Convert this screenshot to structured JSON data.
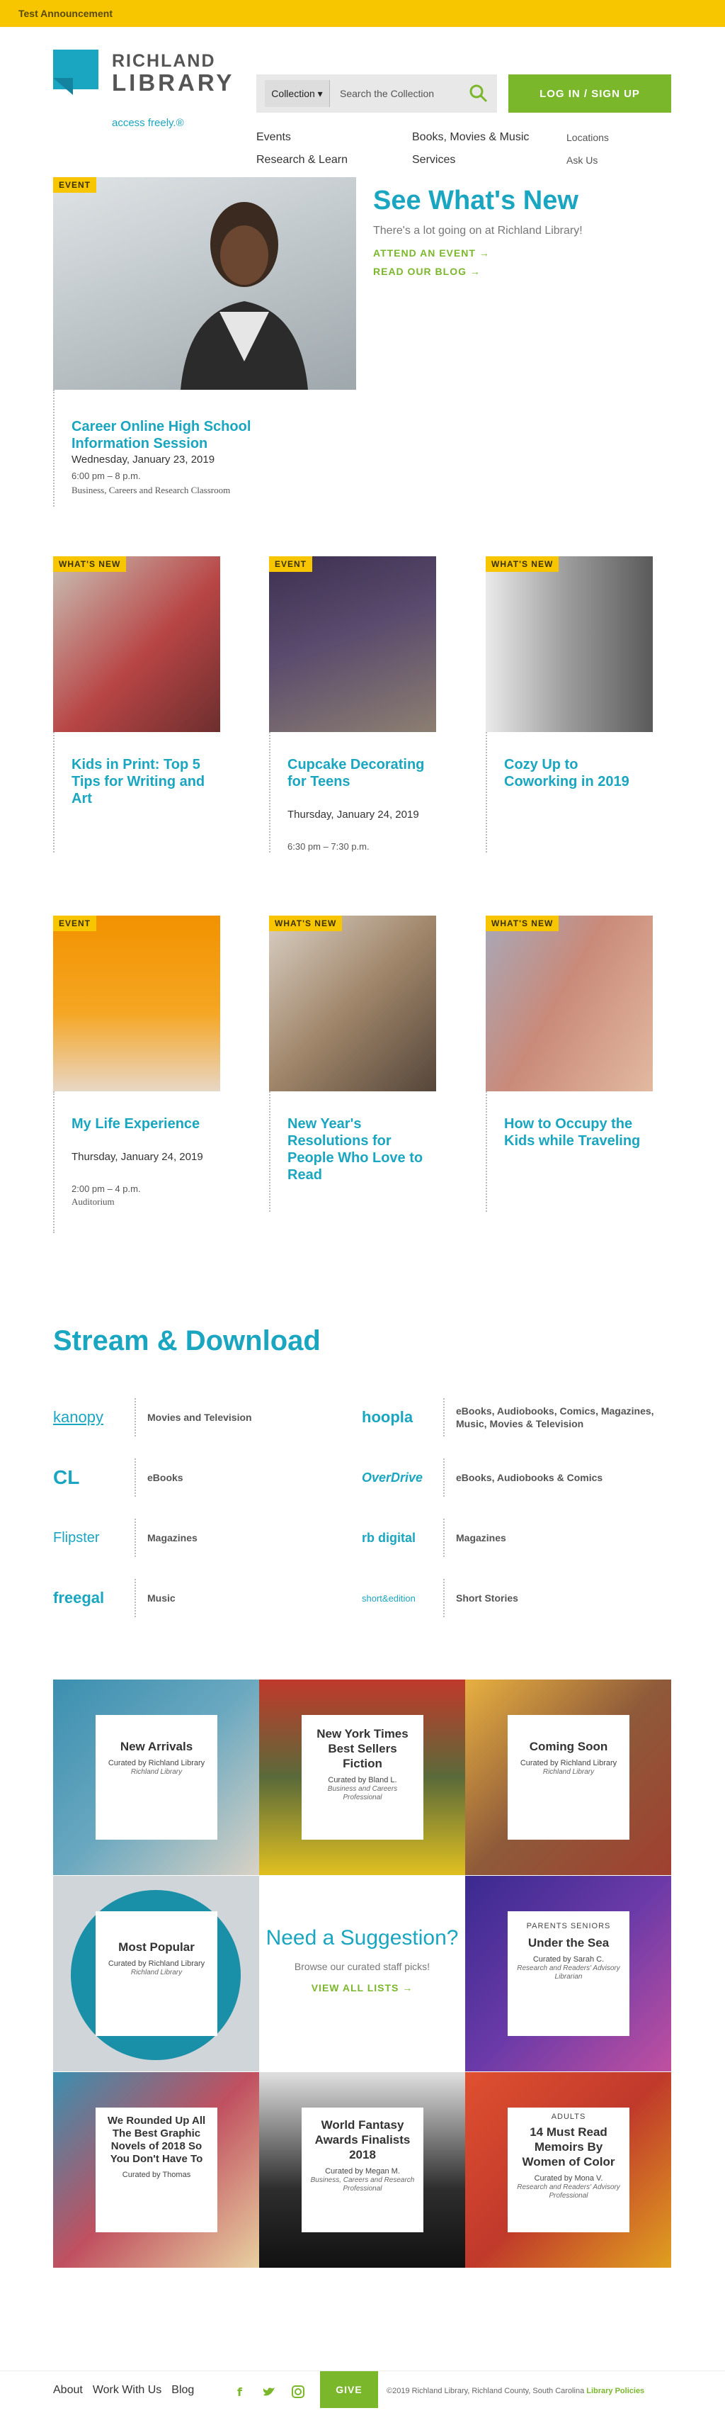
{
  "announcement": "Test Announcement",
  "brand": {
    "line1": "RICHLAND",
    "line2": "LIBRARY",
    "tagline": "access freely.®"
  },
  "search": {
    "scope": "Collection",
    "placeholder": "Search the Collection"
  },
  "login": "LOG IN / SIGN UP",
  "nav": {
    "col1": [
      "Events",
      "Research & Learn"
    ],
    "col2": [
      "Books, Movies & Music",
      "Services"
    ],
    "col3": [
      "Locations",
      "Ask Us"
    ]
  },
  "hero": {
    "tag": "EVENT",
    "title": "Career Online High School Information Session",
    "date": "Wednesday, January 23, 2019",
    "time": "6:00 pm – 8 p.m.",
    "location": "Business, Careers and Research Classroom",
    "heading": "See What's New",
    "sub": "There's a lot going on at Richland Library!",
    "link1": "ATTEND AN EVENT →",
    "link2": "READ OUR BLOG →"
  },
  "cards": [
    {
      "tag": "WHAT'S NEW",
      "title": "Kids in Print: Top 5 Tips for Writing and Art",
      "color": "#b84545"
    },
    {
      "tag": "EVENT",
      "title": "Cupcake Decorating for Teens",
      "date": "Thursday, January 24, 2019",
      "time": "6:30 pm – 7:30 p.m.",
      "color": "#5b4b6e"
    },
    {
      "tag": "WHAT'S NEW",
      "title": "Cozy Up to Coworking in 2019",
      "color": "#7a7a7a"
    },
    {
      "tag": "EVENT",
      "title": "My Life Experience",
      "date": "Thursday, January 24, 2019",
      "time": "2:00 pm – 4 p.m.",
      "location": "Auditorium",
      "color": "#f29200"
    },
    {
      "tag": "WHAT'S NEW",
      "title": "New Year's Resolutions for People Who Love to Read",
      "color": "#a0866a"
    },
    {
      "tag": "WHAT'S NEW",
      "title": "How to Occupy the Kids while Traveling",
      "color": "#c98a7a"
    }
  ],
  "stream": {
    "heading": "Stream & Download",
    "services": [
      {
        "logo": "kanopy",
        "desc": "Movies and Television"
      },
      {
        "logo": "hoopla",
        "desc": "eBooks, Audiobooks, Comics, Magazines, Music, Movies & Television"
      },
      {
        "logo": "CL",
        "desc": "eBooks"
      },
      {
        "logo": "OverDrive",
        "desc": "eBooks, Audiobooks & Comics"
      },
      {
        "logo": "Flipster",
        "desc": "Magazines"
      },
      {
        "logo": "rb digital",
        "desc": "Magazines"
      },
      {
        "logo": "freegal",
        "desc": "Music"
      },
      {
        "logo": "short&edition",
        "desc": "Short Stories"
      }
    ]
  },
  "lists": [
    {
      "title": "New Arrivals",
      "curator": "Curated by Richland Library",
      "role": "Richland Library",
      "bg": "#3b8fb0"
    },
    {
      "title": "New York Times Best Sellers Fiction",
      "curator": "Curated by Bland L.",
      "role": "Business and Careers Professional",
      "bg": "#c0392b"
    },
    {
      "title": "Coming Soon",
      "curator": "Curated by Richland Library",
      "role": "Richland Library",
      "bg": "#8e5a3a"
    },
    {
      "title": "Most Popular",
      "curator": "Curated by Richland Library",
      "role": "Richland Library",
      "bg": "#1a8fa8"
    },
    {
      "title": "Under the Sea",
      "kicker": "PARENTS SENIORS",
      "curator": "Curated by Sarah C.",
      "role": "Research and Readers' Advisory Librarian",
      "bg": "#6a3aa8"
    },
    {
      "title": "We Rounded Up All The Best Graphic Novels of 2018 So You Don't Have To",
      "curator": "Curated by Thomas",
      "role": "",
      "bg": "#3b8fb0"
    },
    {
      "title": "World Fantasy Awards Finalists 2018",
      "curator": "Curated by Megan M.",
      "role": "Business, Careers and Research Professional",
      "bg": "#2d2d2d"
    },
    {
      "title": "14 Must Read Memoirs By Women of Color",
      "kicker": "ADULTS",
      "curator": "Curated by Mona V.",
      "role": "Research and Readers' Advisory Professional",
      "bg": "#c0392b"
    }
  ],
  "suggest": {
    "title": "Need a Suggestion?",
    "sub": "Browse our curated staff picks!",
    "link": "VIEW ALL LISTS →"
  },
  "footer": {
    "links": [
      "About",
      "Work With Us",
      "Blog"
    ],
    "give": "GIVE",
    "copy": "©2019 Richland Library, Richland County, South Carolina",
    "policy": "Library Policies"
  }
}
